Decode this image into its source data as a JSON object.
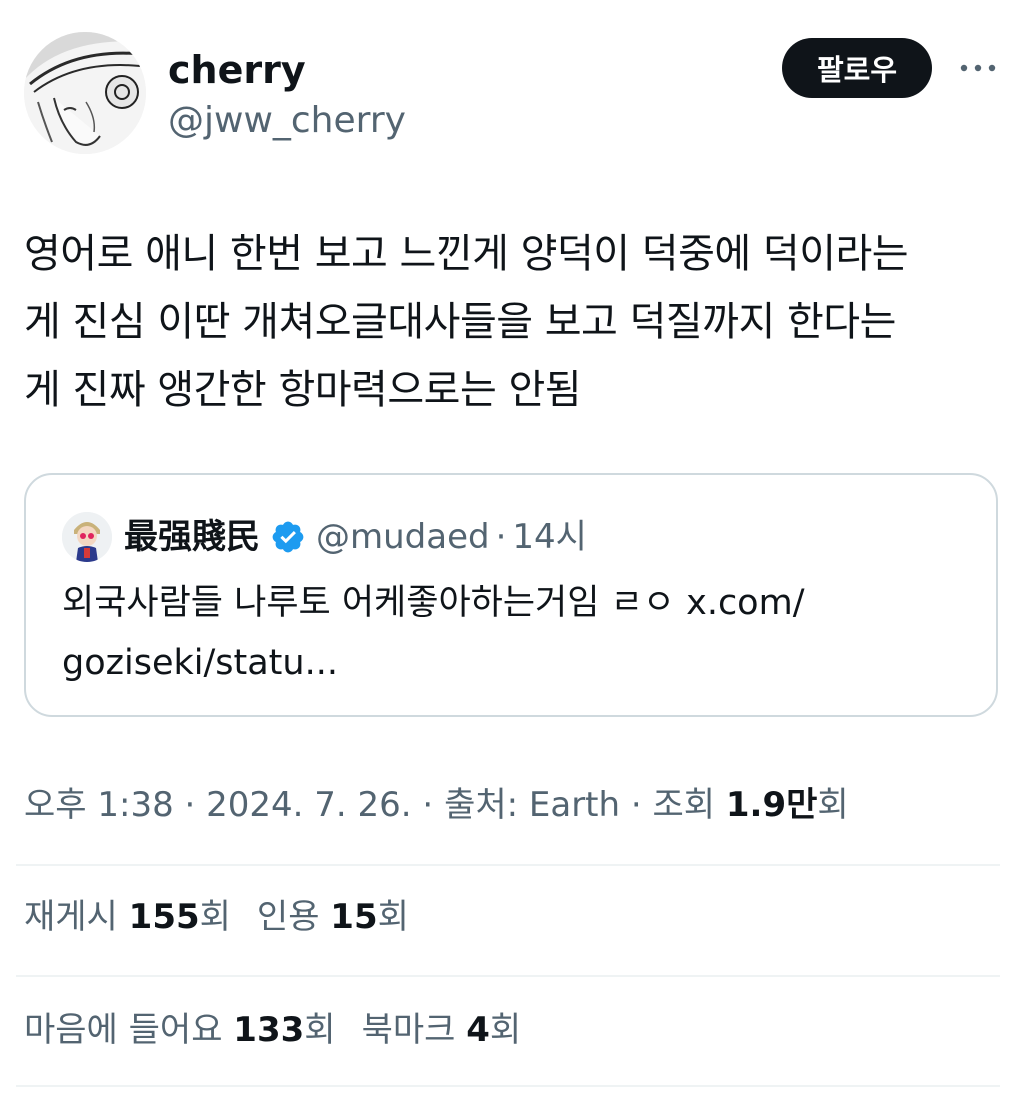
{
  "author": {
    "display_name": "cherry",
    "handle": "@jww_cherry"
  },
  "follow_label": "팔로우",
  "tweet": {
    "text": "영어로 애니 한번 보고 느낀게 양덕이 덕중에 덕이라는\n게 진심 이딴 개쳐오글대사들을 보고 덕질까지 한다는\n게 진짜 앵간한 항마력으로는 안됨"
  },
  "quote": {
    "display_name": "最强賤民",
    "handle": "@mudaed",
    "separator": "·",
    "time": "14시",
    "text": "외국사람들 나루토 어케좋아하는거임 ㄹㅇ x.com/\ngoziseki/statu..."
  },
  "meta": {
    "time": "오후 1:38",
    "sep1": " · ",
    "date": "2024. 7. 26.",
    "sep2": " · ",
    "source": "출처: Earth",
    "sep3": " · ",
    "views_label": "조회 ",
    "views_value": "1.9만",
    "views_suffix": "회"
  },
  "stats": {
    "reposts_label": "재게시 ",
    "reposts_value": "155",
    "reposts_suffix": "회",
    "quotes_label": "인용 ",
    "quotes_value": "15",
    "quotes_suffix": "회",
    "likes_label": "마음에 들어요 ",
    "likes_value": "133",
    "likes_suffix": "회",
    "bookmarks_label": "북마크 ",
    "bookmarks_value": "4",
    "bookmarks_suffix": "회"
  },
  "colors": {
    "text_primary": "#0f1419",
    "text_secondary": "#536471",
    "border": "#cfd9de",
    "divider": "#eff3f4",
    "verified": "#1d9bf0"
  },
  "icons": {
    "more": "more-horizontal-icon",
    "verified": "verified-badge-icon"
  }
}
